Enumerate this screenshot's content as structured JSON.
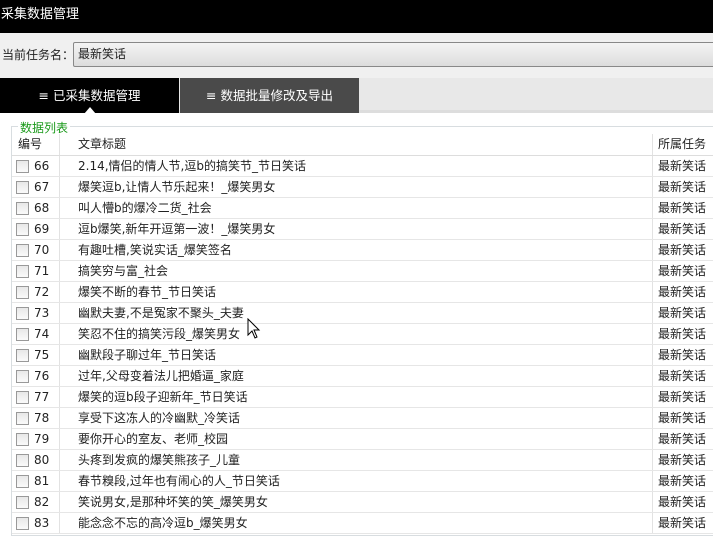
{
  "window": {
    "title": "采集数据管理"
  },
  "task": {
    "label": "当前任务名：",
    "value": "最新笑话"
  },
  "tabs": [
    {
      "label": "≡ 已采集数据管理",
      "active": true
    },
    {
      "label": "≡ 数据批量修改及导出",
      "active": false
    }
  ],
  "group": {
    "label": "数据列表"
  },
  "table": {
    "headers": [
      "编号",
      "文章标题",
      "所属任务"
    ],
    "rows": [
      {
        "id": "66",
        "title": "2.14,情侣的情人节,逗b的搞笑节_节日笑话",
        "task": "最新笑话"
      },
      {
        "id": "67",
        "title": "爆笑逗b,让情人节乐起来！_爆笑男女",
        "task": "最新笑话"
      },
      {
        "id": "68",
        "title": "叫人懵b的爆冷二货_社会",
        "task": "最新笑话"
      },
      {
        "id": "69",
        "title": "逗b爆笑,新年开逗第一波！_爆笑男女",
        "task": "最新笑话"
      },
      {
        "id": "70",
        "title": "有趣吐槽,笑说实话_爆笑签名",
        "task": "最新笑话"
      },
      {
        "id": "71",
        "title": "搞笑穷与富_社会",
        "task": "最新笑话"
      },
      {
        "id": "72",
        "title": "爆笑不断的春节_节日笑话",
        "task": "最新笑话"
      },
      {
        "id": "73",
        "title": "幽默夫妻,不是冤家不聚头_夫妻",
        "task": "最新笑话"
      },
      {
        "id": "74",
        "title": "笑忍不住的搞笑污段_爆笑男女",
        "task": "最新笑话"
      },
      {
        "id": "75",
        "title": "幽默段子聊过年_节日笑话",
        "task": "最新笑话"
      },
      {
        "id": "76",
        "title": "过年,父母变着法儿把婚逼_家庭",
        "task": "最新笑话"
      },
      {
        "id": "77",
        "title": "爆笑的逗b段子迎新年_节日笑话",
        "task": "最新笑话"
      },
      {
        "id": "78",
        "title": "享受下这冻人的冷幽默_冷笑话",
        "task": "最新笑话"
      },
      {
        "id": "79",
        "title": "要你开心的室友、老师_校园",
        "task": "最新笑话"
      },
      {
        "id": "80",
        "title": "头疼到发疯的爆笑熊孩子_儿童",
        "task": "最新笑话"
      },
      {
        "id": "81",
        "title": "春节糗段,过年也有闹心的人_节日笑话",
        "task": "最新笑话"
      },
      {
        "id": "82",
        "title": "笑说男女,是那种坏笑的笑_爆笑男女",
        "task": "最新笑话"
      },
      {
        "id": "83",
        "title": "能念念不忘的高冷逗b_爆笑男女",
        "task": "最新笑话"
      }
    ]
  }
}
